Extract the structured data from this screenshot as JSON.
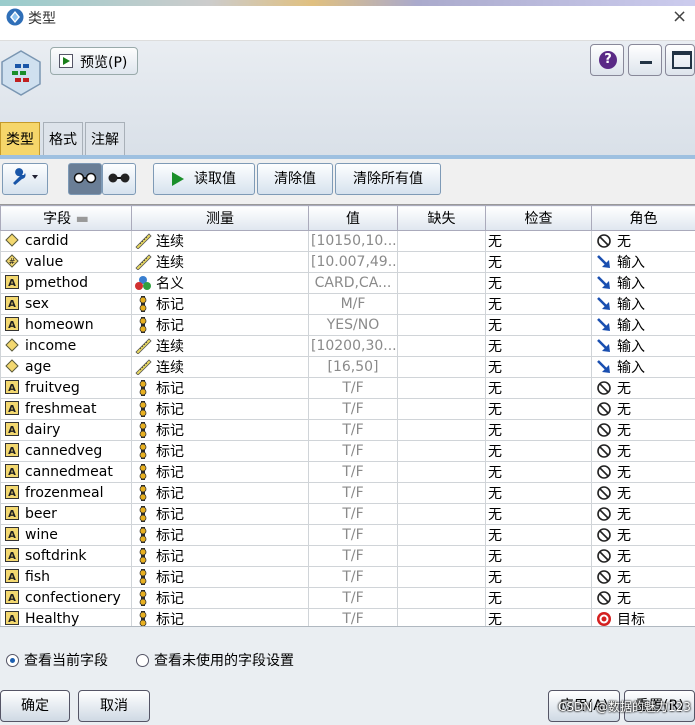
{
  "window": {
    "title": "类型",
    "close": "×"
  },
  "header": {
    "preview_label": "预览(P)",
    "help": "?"
  },
  "tabs": [
    "类型",
    "格式",
    "注解"
  ],
  "toolbar": {
    "read": "读取值",
    "clear": "清除值",
    "clear_all": "清除所有值"
  },
  "columns": [
    "字段",
    "测量",
    "值",
    "缺失",
    "检查",
    "角色"
  ],
  "rows": [
    {
      "field": "cardid",
      "ftype": "continuous",
      "measure": "连续",
      "mtype": "continuous",
      "value": "[10150,10...",
      "missing": "",
      "check": "无",
      "role": "无",
      "rtype": "none"
    },
    {
      "field": "value",
      "ftype": "real",
      "measure": "连续",
      "mtype": "continuous",
      "value": "[10.007,49...",
      "missing": "",
      "check": "无",
      "role": "输入",
      "rtype": "input"
    },
    {
      "field": "pmethod",
      "ftype": "string",
      "measure": "名义",
      "mtype": "nominal",
      "value": "CARD,CA...",
      "missing": "",
      "check": "无",
      "role": "输入",
      "rtype": "input"
    },
    {
      "field": "sex",
      "ftype": "string",
      "measure": "标记",
      "mtype": "flag",
      "value": "M/F",
      "missing": "",
      "check": "无",
      "role": "输入",
      "rtype": "input"
    },
    {
      "field": "homeown",
      "ftype": "string",
      "measure": "标记",
      "mtype": "flag",
      "value": "YES/NO",
      "missing": "",
      "check": "无",
      "role": "输入",
      "rtype": "input"
    },
    {
      "field": "income",
      "ftype": "continuous",
      "measure": "连续",
      "mtype": "continuous",
      "value": "[10200,30...",
      "missing": "",
      "check": "无",
      "role": "输入",
      "rtype": "input"
    },
    {
      "field": "age",
      "ftype": "continuous",
      "measure": "连续",
      "mtype": "continuous",
      "value": "[16,50]",
      "missing": "",
      "check": "无",
      "role": "输入",
      "rtype": "input"
    },
    {
      "field": "fruitveg",
      "ftype": "string",
      "measure": "标记",
      "mtype": "flag",
      "value": "T/F",
      "missing": "",
      "check": "无",
      "role": "无",
      "rtype": "none"
    },
    {
      "field": "freshmeat",
      "ftype": "string",
      "measure": "标记",
      "mtype": "flag",
      "value": "T/F",
      "missing": "",
      "check": "无",
      "role": "无",
      "rtype": "none"
    },
    {
      "field": "dairy",
      "ftype": "string",
      "measure": "标记",
      "mtype": "flag",
      "value": "T/F",
      "missing": "",
      "check": "无",
      "role": "无",
      "rtype": "none"
    },
    {
      "field": "cannedveg",
      "ftype": "string",
      "measure": "标记",
      "mtype": "flag",
      "value": "T/F",
      "missing": "",
      "check": "无",
      "role": "无",
      "rtype": "none"
    },
    {
      "field": "cannedmeat",
      "ftype": "string",
      "measure": "标记",
      "mtype": "flag",
      "value": "T/F",
      "missing": "",
      "check": "无",
      "role": "无",
      "rtype": "none"
    },
    {
      "field": "frozenmeal",
      "ftype": "string",
      "measure": "标记",
      "mtype": "flag",
      "value": "T/F",
      "missing": "",
      "check": "无",
      "role": "无",
      "rtype": "none"
    },
    {
      "field": "beer",
      "ftype": "string",
      "measure": "标记",
      "mtype": "flag",
      "value": "T/F",
      "missing": "",
      "check": "无",
      "role": "无",
      "rtype": "none"
    },
    {
      "field": "wine",
      "ftype": "string",
      "measure": "标记",
      "mtype": "flag",
      "value": "T/F",
      "missing": "",
      "check": "无",
      "role": "无",
      "rtype": "none"
    },
    {
      "field": "softdrink",
      "ftype": "string",
      "measure": "标记",
      "mtype": "flag",
      "value": "T/F",
      "missing": "",
      "check": "无",
      "role": "无",
      "rtype": "none"
    },
    {
      "field": "fish",
      "ftype": "string",
      "measure": "标记",
      "mtype": "flag",
      "value": "T/F",
      "missing": "",
      "check": "无",
      "role": "无",
      "rtype": "none"
    },
    {
      "field": "confectionery",
      "ftype": "string",
      "measure": "标记",
      "mtype": "flag",
      "value": "T/F",
      "missing": "",
      "check": "无",
      "role": "无",
      "rtype": "none"
    },
    {
      "field": "Healthy",
      "ftype": "string",
      "measure": "标记",
      "mtype": "flag",
      "value": "T/F",
      "missing": "",
      "check": "无",
      "role": "目标",
      "rtype": "target"
    }
  ],
  "bottom": {
    "radio_current": "查看当前字段",
    "radio_unused": "查看未使用的字段设置",
    "ok": "确定",
    "cancel": "取消",
    "apply": "应用(A)",
    "reset": "重置(R)",
    "watermark": "CSDN @数据的魅力123"
  },
  "colors": {
    "tab_active": "#f6d66a",
    "input_arrow": "#1a4fb0",
    "target_red": "#d42020",
    "header_bg": "#e3e8ee"
  }
}
